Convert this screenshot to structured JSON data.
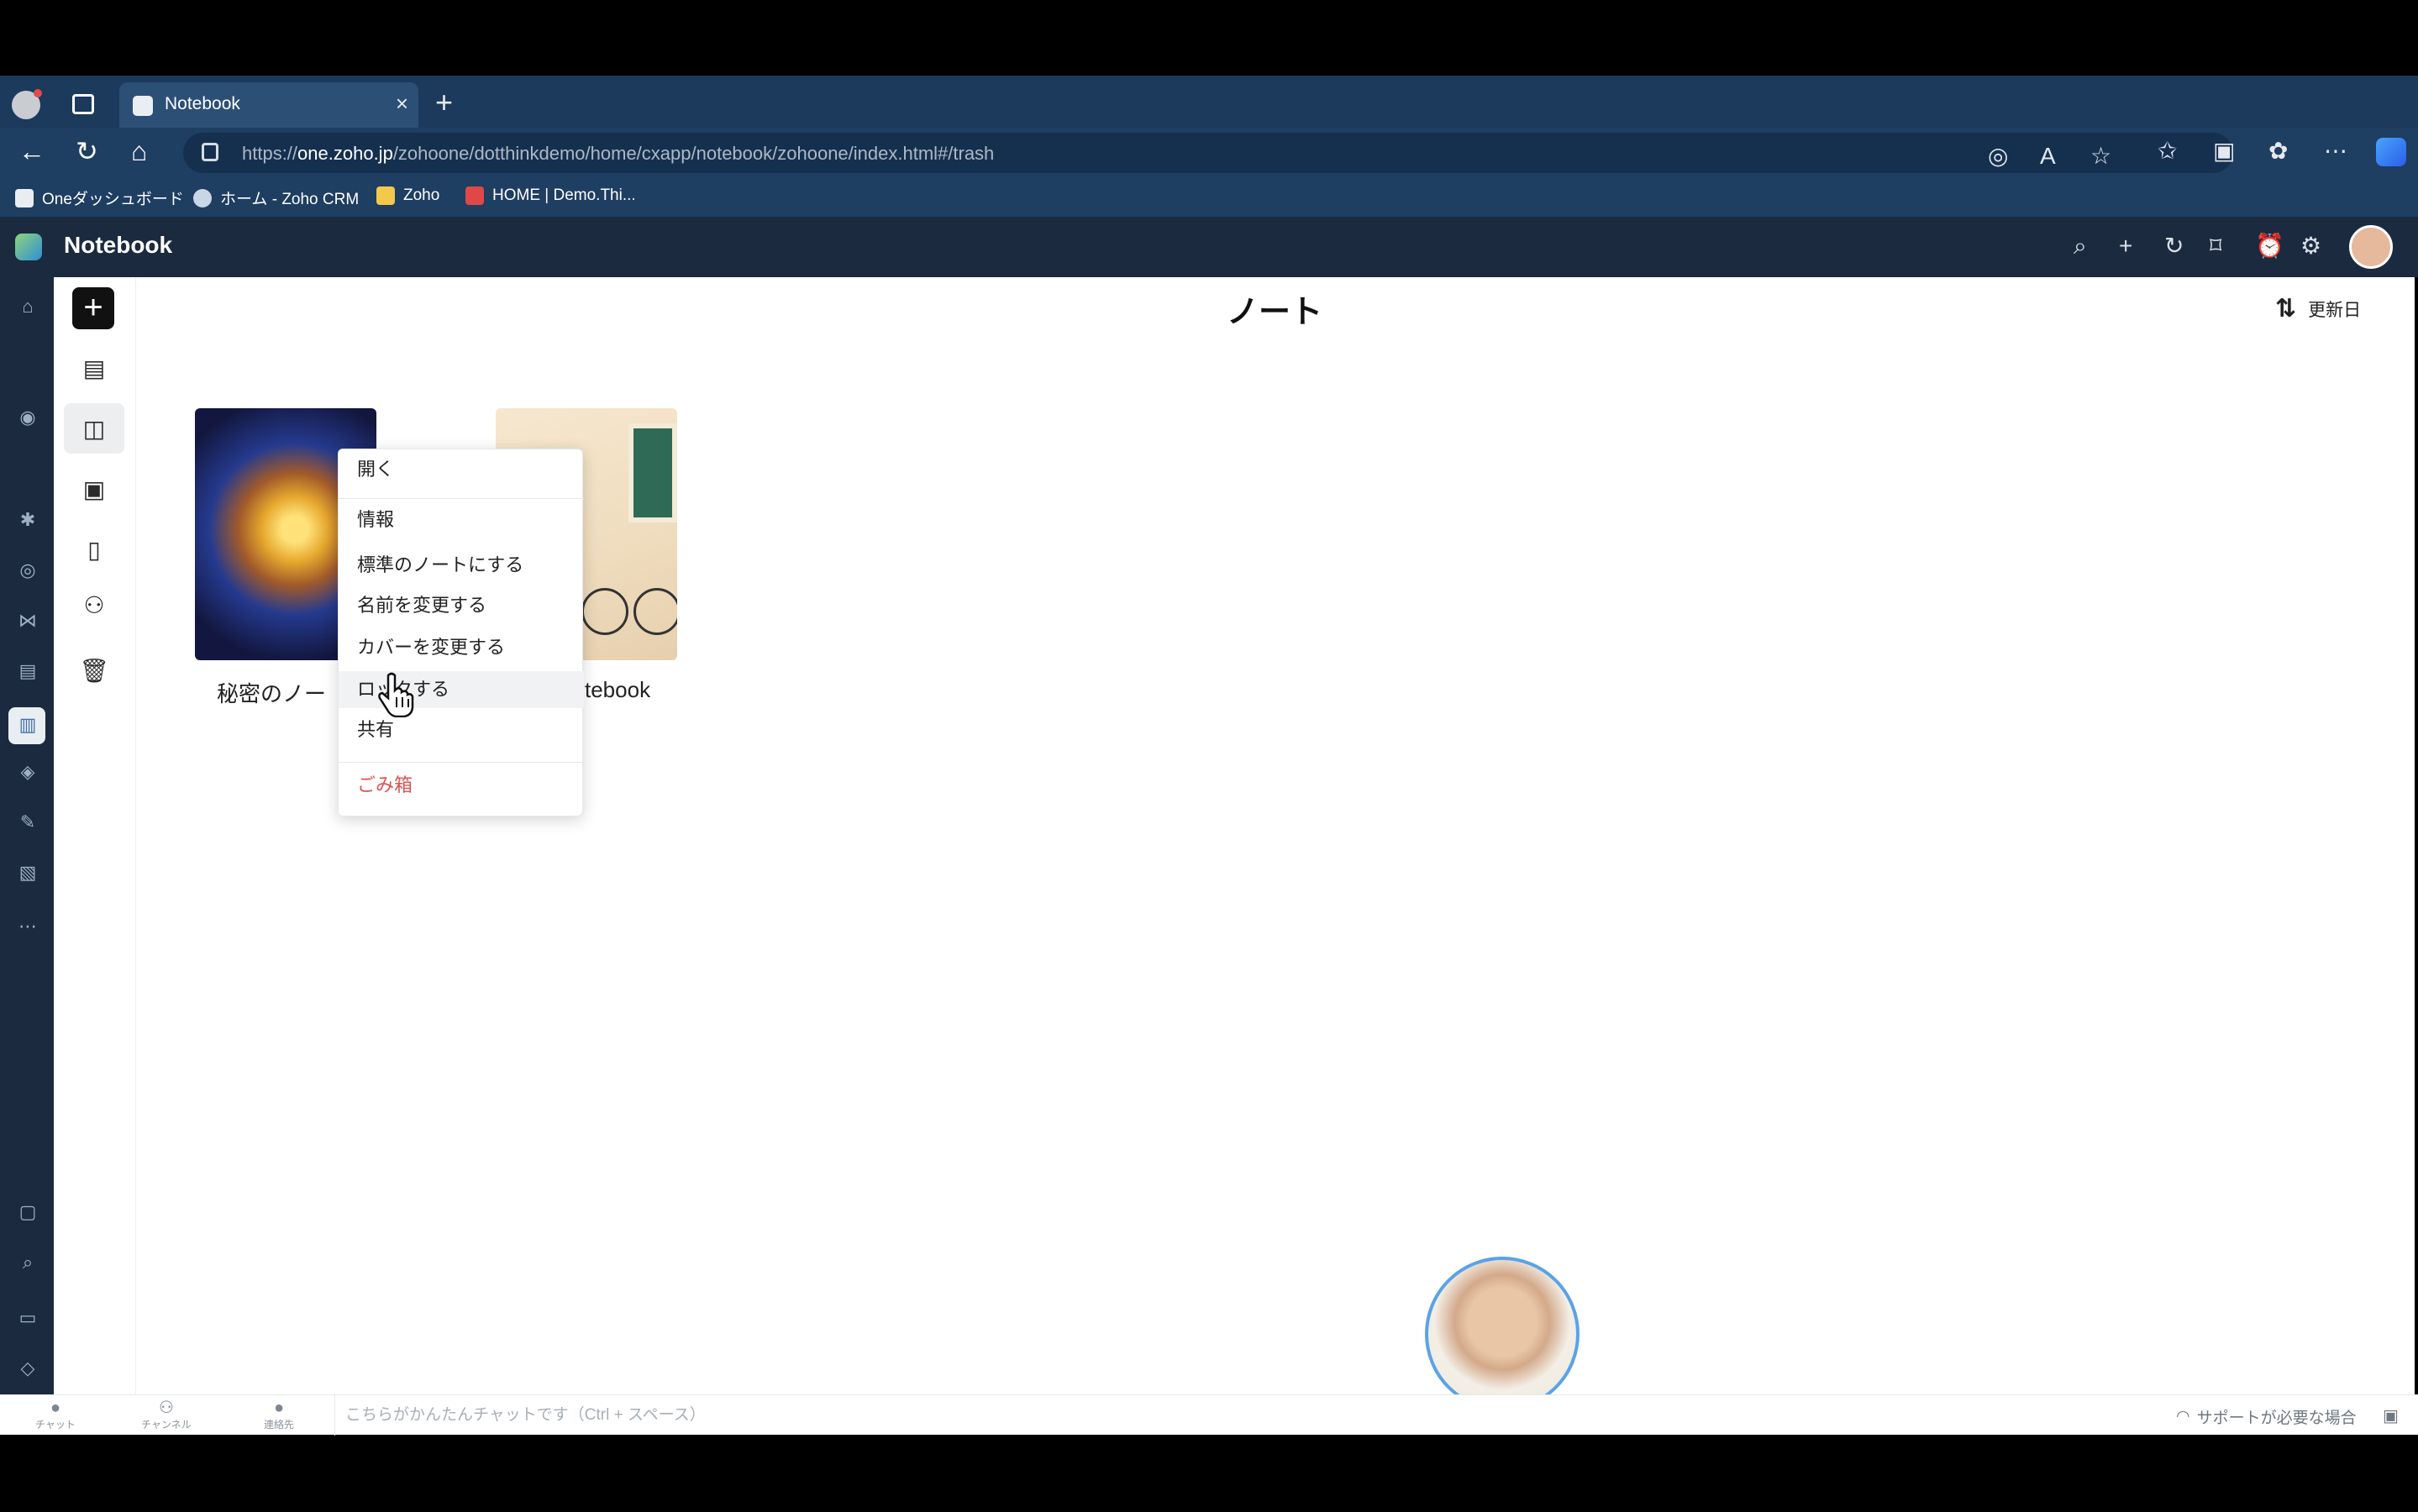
{
  "browser": {
    "tab_title": "Notebook",
    "tab_close": "×",
    "new_tab": "+",
    "url_prefix": "https://",
    "url_host": "one.zoho.jp",
    "url_path": "/zohoone/dotthinkdemo/home/cxapp/notebook/zohoone/index.html#/trash",
    "bookmarks": [
      {
        "label": "Oneダッシュボード",
        "icon": "zoho-one-icon",
        "color": "#e9edf2"
      },
      {
        "label": "ホーム - Zoho CRM",
        "icon": "crm-icon",
        "color": "#c9d6e6"
      },
      {
        "label": "Zoho",
        "icon": "folder-icon",
        "color": "#f2c94c"
      },
      {
        "label": "HOME | Demo.Thi...",
        "icon": "d-logo-icon",
        "color": "#e04848"
      }
    ]
  },
  "app": {
    "title": "Notebook"
  },
  "main": {
    "page_title": "ノート",
    "sort_label": "更新日",
    "notebooks": [
      {
        "name": "秘密のノー"
      },
      {
        "name": "tebook"
      }
    ]
  },
  "context_menu": {
    "items": [
      {
        "label": "開く"
      },
      {
        "label": "情報"
      },
      {
        "label": "標準のノートにする"
      },
      {
        "label": "名前を変更する"
      },
      {
        "label": "カバーを変更する"
      },
      {
        "label": "ロックする"
      },
      {
        "label": "共有"
      },
      {
        "label": "ごみ箱"
      }
    ],
    "hover_index": 5
  },
  "bottom_bar": {
    "items": [
      {
        "label": "チャット"
      },
      {
        "label": "チャンネル"
      },
      {
        "label": "連絡先"
      }
    ],
    "chat_placeholder": "こちらがかんたんチャットです（Ctrl + スペース）",
    "support_label": "サポートが必要な場合"
  },
  "colors": {
    "chrome": "#1b3a5c",
    "app_header": "#1b2a3f",
    "danger": "#d9534f"
  }
}
